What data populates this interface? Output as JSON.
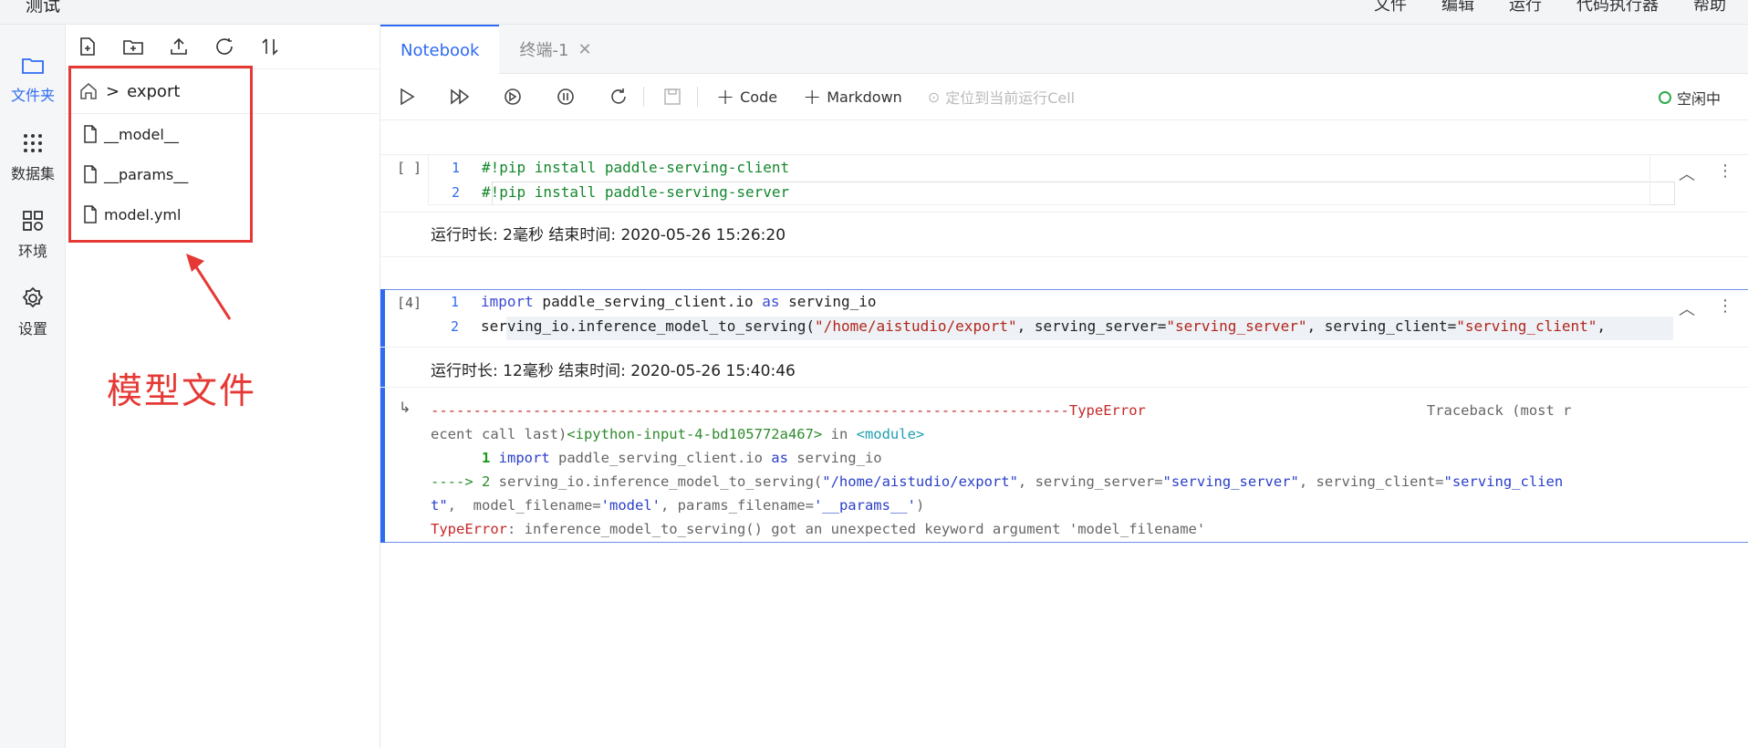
{
  "topbar": {
    "title": "测试",
    "menu": [
      "文件",
      "编辑",
      "运行",
      "代码执行器",
      "帮助"
    ]
  },
  "rail": [
    {
      "label": "文件夹",
      "icon": "folder-icon",
      "active": true
    },
    {
      "label": "数据集",
      "icon": "dataset-icon",
      "active": false
    },
    {
      "label": "环境",
      "icon": "grid-icon",
      "active": false
    },
    {
      "label": "设置",
      "icon": "gear-icon",
      "active": false
    }
  ],
  "filepane": {
    "breadcrumb_sep": ">",
    "breadcrumb_folder": "export",
    "files": [
      "__model__",
      "__params__",
      "model.yml"
    ]
  },
  "annotation": {
    "label": "模型文件",
    "color": "#e53935"
  },
  "tabs": [
    {
      "label": "Notebook",
      "active": true
    },
    {
      "label": "终端-1",
      "active": false
    }
  ],
  "toolbar": {
    "code_label": "Code",
    "markdown_label": "Markdown",
    "locate_label": "定位到当前运行Cell",
    "status_label": "空闲中"
  },
  "cells": [
    {
      "prompt": "[ ]",
      "lines": [
        {
          "n": "1",
          "text": "#!pip install paddle-serving-client"
        },
        {
          "n": "2",
          "text": "#!pip install paddle-serving-server"
        }
      ],
      "runinfo": "运行时长: 2毫秒    结束时间: 2020-05-26 15:26:20"
    },
    {
      "prompt": "[4]",
      "lines": [
        {
          "n": "1",
          "kw1": "import",
          "t1": " paddle_serving_client.io ",
          "kw2": "as",
          "t2": " serving_io"
        },
        {
          "n": "2",
          "t1": "serving_io.inference_model_to_serving(",
          "s1": "\"/home/aistudio/export\"",
          "t2": ", serving_server=",
          "s2": "\"serving_server\"",
          "t3": ", serving_client=",
          "s3": "\"serving_client\"",
          "t4": ","
        }
      ],
      "runinfo": "运行时长: 12毫秒    结束时间: 2020-05-26 15:40:46",
      "output": {
        "dashes": "---------------------------------------------------------------------------",
        "err_type": "TypeError",
        "traceback_label": "Traceback (most r",
        "line2_prefix": "ecent call last)",
        "line2_input": "<ipython-input-4-bd105772a467>",
        "line2_in": " in ",
        "line2_module": "<module>",
        "line3_num": "      1 ",
        "line3_kw": "import",
        "line3_rest": " paddle_serving_client.io ",
        "line3_as": "as",
        "line3_end": " serving_io",
        "line4_arrow": "----> 2 ",
        "line4_a": "serving_io.inference_model_to_serving(",
        "line4_s1": "\"/home/aistudio/export\"",
        "line4_b": ", serving_server=",
        "line4_s2": "\"serving_server\"",
        "line4_c": ", serving_client=",
        "line4_s3": "\"serving_clien",
        "line5_s3": "t\"",
        "line5_a": ",  model_filename=",
        "line5_s4": "'model'",
        "line5_b": ", params_filename=",
        "line5_s5": "'__params__'",
        "line5_c": ")",
        "line6_err": "TypeError",
        "line6_msg": ": inference_model_to_serving() got an unexpected keyword argument 'model_filename'"
      }
    }
  ]
}
